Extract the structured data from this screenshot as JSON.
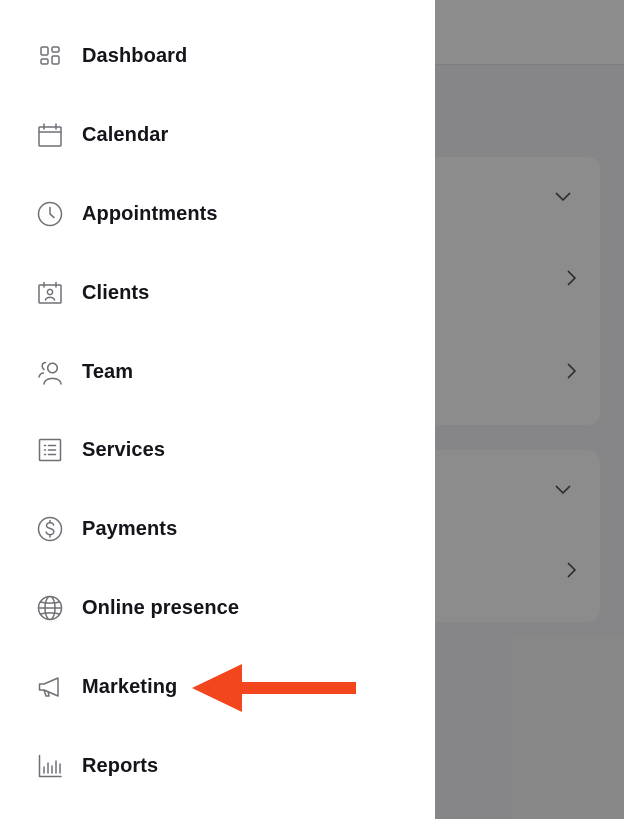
{
  "sidebar": {
    "items": [
      {
        "label": "Dashboard",
        "icon": "dashboard-icon"
      },
      {
        "label": "Calendar",
        "icon": "calendar-icon"
      },
      {
        "label": "Appointments",
        "icon": "clock-icon"
      },
      {
        "label": "Clients",
        "icon": "client-card-icon"
      },
      {
        "label": "Team",
        "icon": "team-icon"
      },
      {
        "label": "Services",
        "icon": "list-icon"
      },
      {
        "label": "Payments",
        "icon": "dollar-icon"
      },
      {
        "label": "Online presence",
        "icon": "globe-icon"
      },
      {
        "label": "Marketing",
        "icon": "megaphone-icon"
      },
      {
        "label": "Reports",
        "icon": "bar-chart-icon"
      }
    ]
  },
  "colors": {
    "icon": "#6f6f76",
    "label": "#14141a",
    "overlay": "rgba(0,0,0,0.45)",
    "annotation_arrow": "#f4461c"
  }
}
